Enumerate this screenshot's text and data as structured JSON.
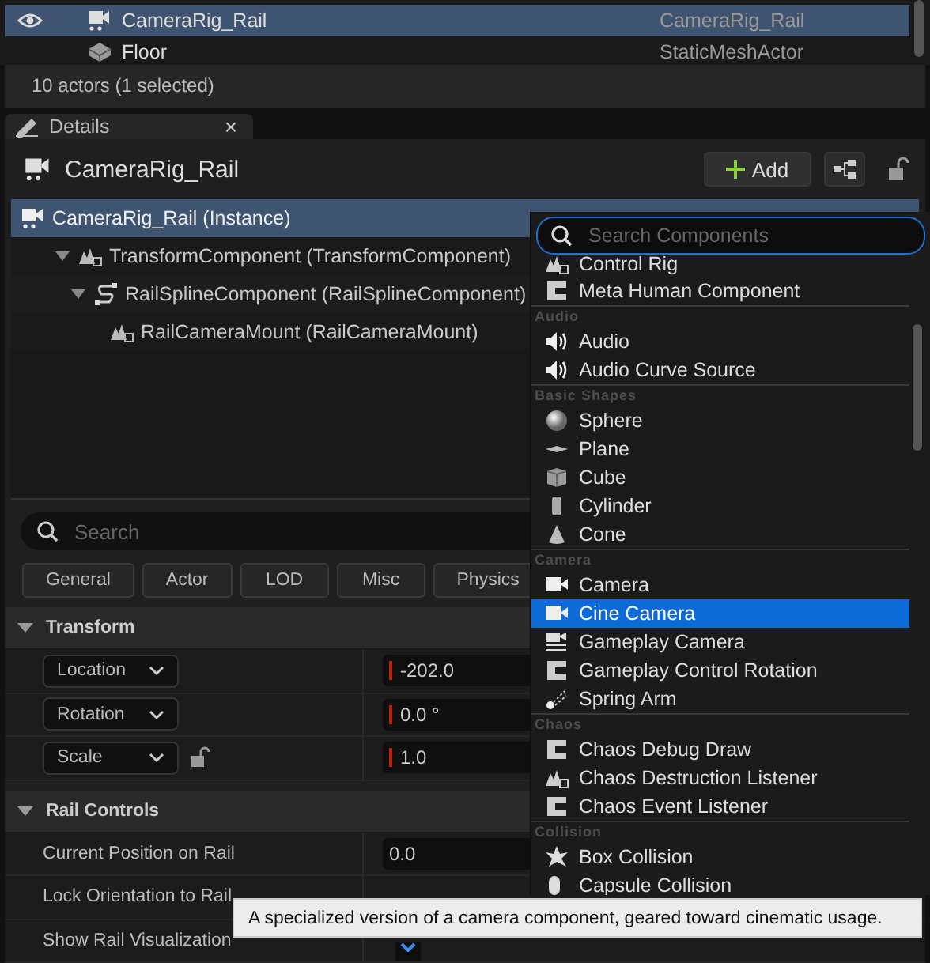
{
  "outliner": {
    "rows": [
      {
        "name": "CameraRig_Rail",
        "type": "CameraRig_Rail",
        "selected": true,
        "visible": true
      },
      {
        "name": "Floor",
        "type": "StaticMeshActor",
        "selected": false,
        "visible": false
      }
    ],
    "status": "10 actors (1 selected)"
  },
  "details": {
    "tab": "Details",
    "close": "×",
    "actor": "CameraRig_Rail",
    "add_button": "Add",
    "components": [
      {
        "label": "CameraRig_Rail (Instance)",
        "selected": true,
        "children": [
          {
            "label": "TransformComponent (TransformComponent)",
            "selected": false,
            "expanded": true,
            "children": [
              {
                "label": "RailSplineComponent (RailSplineComponent)",
                "selected": false,
                "expanded": true,
                "children": [
                  {
                    "label": "RailCameraMount (RailCameraMount)",
                    "selected": false
                  }
                ]
              }
            ]
          }
        ]
      }
    ],
    "search": {
      "placeholder": "Search"
    },
    "filters": [
      {
        "label": "General"
      },
      {
        "label": "Actor"
      },
      {
        "label": "LOD"
      },
      {
        "label": "Misc"
      },
      {
        "label": "Physics"
      }
    ],
    "sections": [
      {
        "title": "Transform",
        "expanded": true,
        "rows": [
          {
            "kind": "dropdown",
            "label": "Location",
            "value": "-202.0"
          },
          {
            "kind": "dropdown",
            "label": "Rotation",
            "value": "0.0 °"
          },
          {
            "kind": "dropdown",
            "label": "Scale",
            "value": "1.0",
            "lock": true
          }
        ]
      },
      {
        "title": "Rail Controls",
        "expanded": true,
        "rows": [
          {
            "kind": "number",
            "label": "Current Position on Rail",
            "value": "0.0"
          },
          {
            "kind": "checkbox",
            "label": "Lock Orientation to Rail"
          },
          {
            "kind": "checkbox",
            "label": "Show Rail Visualization",
            "checked": true
          }
        ]
      }
    ]
  },
  "add_menu": {
    "search": {
      "placeholder": "Search Components"
    },
    "entries": [
      {
        "kind": "item",
        "label": "Control Rig",
        "selected": false
      },
      {
        "kind": "item",
        "label": "Meta Human Component",
        "selected": false
      },
      {
        "kind": "header",
        "label": "Audio"
      },
      {
        "kind": "item",
        "label": "Audio",
        "selected": false
      },
      {
        "kind": "item",
        "label": "Audio Curve Source",
        "selected": false
      },
      {
        "kind": "header",
        "label": "Basic Shapes"
      },
      {
        "kind": "item",
        "label": "Sphere",
        "selected": false
      },
      {
        "kind": "item",
        "label": "Plane",
        "selected": false
      },
      {
        "kind": "item",
        "label": "Cube",
        "selected": false
      },
      {
        "kind": "item",
        "label": "Cylinder",
        "selected": false
      },
      {
        "kind": "item",
        "label": "Cone",
        "selected": false
      },
      {
        "kind": "header",
        "label": "Camera"
      },
      {
        "kind": "item",
        "label": "Camera",
        "selected": false
      },
      {
        "kind": "item",
        "label": "Cine Camera",
        "selected": true
      },
      {
        "kind": "item",
        "label": "Gameplay Camera",
        "selected": false
      },
      {
        "kind": "item",
        "label": "Gameplay Control Rotation",
        "selected": false
      },
      {
        "kind": "item",
        "label": "Spring Arm",
        "selected": false
      },
      {
        "kind": "header",
        "label": "Chaos"
      },
      {
        "kind": "item",
        "label": "Chaos Debug Draw",
        "selected": false
      },
      {
        "kind": "item",
        "label": "Chaos Destruction Listener",
        "selected": false
      },
      {
        "kind": "item",
        "label": "Chaos Event Listener",
        "selected": false
      },
      {
        "kind": "header",
        "label": "Collision"
      },
      {
        "kind": "item",
        "label": "Box Collision",
        "selected": false
      },
      {
        "kind": "item",
        "label": "Capsule Collision",
        "selected": false
      }
    ]
  },
  "tooltip": "A specialized version of a camera component, geared toward cinematic usage."
}
